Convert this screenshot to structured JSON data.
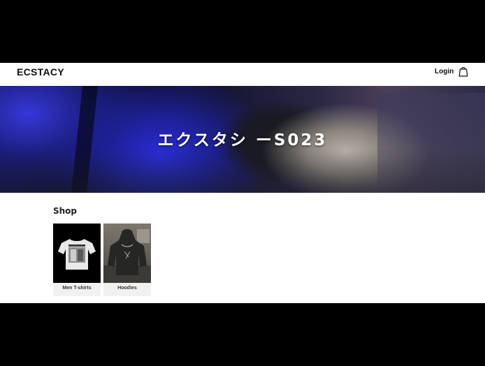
{
  "brand": {
    "logo": "ECSTACY"
  },
  "header": {
    "login_label": "Login",
    "cart_icon": "shopping-bag-icon"
  },
  "hero": {
    "title": "エクスタシ ーS023"
  },
  "shop": {
    "heading": "Shop",
    "categories": [
      {
        "label": "Men T-shirts",
        "image": "white-tshirt-on-black"
      },
      {
        "label": "Hoodies",
        "image": "black-hoodie-photo"
      }
    ]
  },
  "colors": {
    "page_bg": "#ffffff",
    "letterbox": "#000000",
    "text": "#111111",
    "card_bg": "#f1f1f1",
    "hero_blue": "#2a2dd6"
  }
}
